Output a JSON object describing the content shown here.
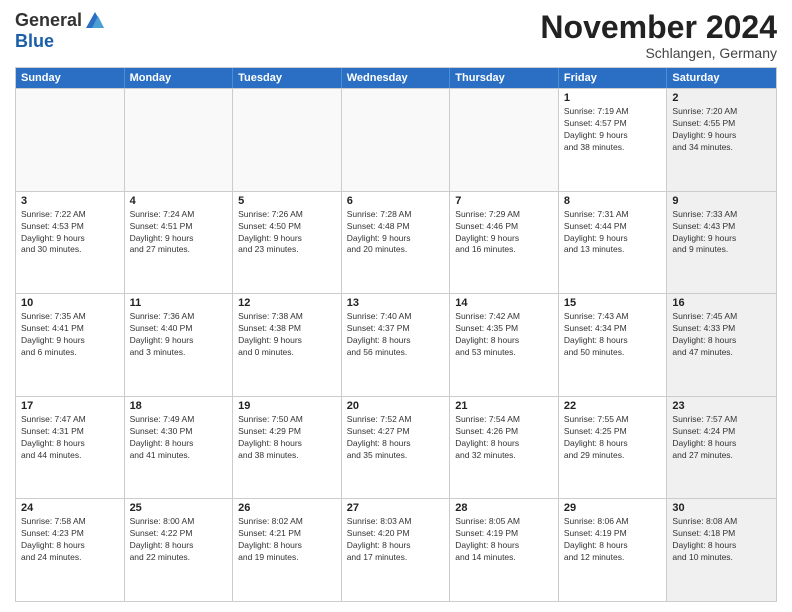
{
  "logo": {
    "line1": "General",
    "line2": "Blue"
  },
  "title": "November 2024",
  "subtitle": "Schlangen, Germany",
  "header_days": [
    "Sunday",
    "Monday",
    "Tuesday",
    "Wednesday",
    "Thursday",
    "Friday",
    "Saturday"
  ],
  "weeks": [
    [
      {
        "day": "",
        "info": "",
        "shaded": false,
        "empty": true
      },
      {
        "day": "",
        "info": "",
        "shaded": false,
        "empty": true
      },
      {
        "day": "",
        "info": "",
        "shaded": false,
        "empty": true
      },
      {
        "day": "",
        "info": "",
        "shaded": false,
        "empty": true
      },
      {
        "day": "",
        "info": "",
        "shaded": false,
        "empty": true
      },
      {
        "day": "1",
        "info": "Sunrise: 7:19 AM\nSunset: 4:57 PM\nDaylight: 9 hours\nand 38 minutes.",
        "shaded": false,
        "empty": false
      },
      {
        "day": "2",
        "info": "Sunrise: 7:20 AM\nSunset: 4:55 PM\nDaylight: 9 hours\nand 34 minutes.",
        "shaded": true,
        "empty": false
      }
    ],
    [
      {
        "day": "3",
        "info": "Sunrise: 7:22 AM\nSunset: 4:53 PM\nDaylight: 9 hours\nand 30 minutes.",
        "shaded": false,
        "empty": false
      },
      {
        "day": "4",
        "info": "Sunrise: 7:24 AM\nSunset: 4:51 PM\nDaylight: 9 hours\nand 27 minutes.",
        "shaded": false,
        "empty": false
      },
      {
        "day": "5",
        "info": "Sunrise: 7:26 AM\nSunset: 4:50 PM\nDaylight: 9 hours\nand 23 minutes.",
        "shaded": false,
        "empty": false
      },
      {
        "day": "6",
        "info": "Sunrise: 7:28 AM\nSunset: 4:48 PM\nDaylight: 9 hours\nand 20 minutes.",
        "shaded": false,
        "empty": false
      },
      {
        "day": "7",
        "info": "Sunrise: 7:29 AM\nSunset: 4:46 PM\nDaylight: 9 hours\nand 16 minutes.",
        "shaded": false,
        "empty": false
      },
      {
        "day": "8",
        "info": "Sunrise: 7:31 AM\nSunset: 4:44 PM\nDaylight: 9 hours\nand 13 minutes.",
        "shaded": false,
        "empty": false
      },
      {
        "day": "9",
        "info": "Sunrise: 7:33 AM\nSunset: 4:43 PM\nDaylight: 9 hours\nand 9 minutes.",
        "shaded": true,
        "empty": false
      }
    ],
    [
      {
        "day": "10",
        "info": "Sunrise: 7:35 AM\nSunset: 4:41 PM\nDaylight: 9 hours\nand 6 minutes.",
        "shaded": false,
        "empty": false
      },
      {
        "day": "11",
        "info": "Sunrise: 7:36 AM\nSunset: 4:40 PM\nDaylight: 9 hours\nand 3 minutes.",
        "shaded": false,
        "empty": false
      },
      {
        "day": "12",
        "info": "Sunrise: 7:38 AM\nSunset: 4:38 PM\nDaylight: 9 hours\nand 0 minutes.",
        "shaded": false,
        "empty": false
      },
      {
        "day": "13",
        "info": "Sunrise: 7:40 AM\nSunset: 4:37 PM\nDaylight: 8 hours\nand 56 minutes.",
        "shaded": false,
        "empty": false
      },
      {
        "day": "14",
        "info": "Sunrise: 7:42 AM\nSunset: 4:35 PM\nDaylight: 8 hours\nand 53 minutes.",
        "shaded": false,
        "empty": false
      },
      {
        "day": "15",
        "info": "Sunrise: 7:43 AM\nSunset: 4:34 PM\nDaylight: 8 hours\nand 50 minutes.",
        "shaded": false,
        "empty": false
      },
      {
        "day": "16",
        "info": "Sunrise: 7:45 AM\nSunset: 4:33 PM\nDaylight: 8 hours\nand 47 minutes.",
        "shaded": true,
        "empty": false
      }
    ],
    [
      {
        "day": "17",
        "info": "Sunrise: 7:47 AM\nSunset: 4:31 PM\nDaylight: 8 hours\nand 44 minutes.",
        "shaded": false,
        "empty": false
      },
      {
        "day": "18",
        "info": "Sunrise: 7:49 AM\nSunset: 4:30 PM\nDaylight: 8 hours\nand 41 minutes.",
        "shaded": false,
        "empty": false
      },
      {
        "day": "19",
        "info": "Sunrise: 7:50 AM\nSunset: 4:29 PM\nDaylight: 8 hours\nand 38 minutes.",
        "shaded": false,
        "empty": false
      },
      {
        "day": "20",
        "info": "Sunrise: 7:52 AM\nSunset: 4:27 PM\nDaylight: 8 hours\nand 35 minutes.",
        "shaded": false,
        "empty": false
      },
      {
        "day": "21",
        "info": "Sunrise: 7:54 AM\nSunset: 4:26 PM\nDaylight: 8 hours\nand 32 minutes.",
        "shaded": false,
        "empty": false
      },
      {
        "day": "22",
        "info": "Sunrise: 7:55 AM\nSunset: 4:25 PM\nDaylight: 8 hours\nand 29 minutes.",
        "shaded": false,
        "empty": false
      },
      {
        "day": "23",
        "info": "Sunrise: 7:57 AM\nSunset: 4:24 PM\nDaylight: 8 hours\nand 27 minutes.",
        "shaded": true,
        "empty": false
      }
    ],
    [
      {
        "day": "24",
        "info": "Sunrise: 7:58 AM\nSunset: 4:23 PM\nDaylight: 8 hours\nand 24 minutes.",
        "shaded": false,
        "empty": false
      },
      {
        "day": "25",
        "info": "Sunrise: 8:00 AM\nSunset: 4:22 PM\nDaylight: 8 hours\nand 22 minutes.",
        "shaded": false,
        "empty": false
      },
      {
        "day": "26",
        "info": "Sunrise: 8:02 AM\nSunset: 4:21 PM\nDaylight: 8 hours\nand 19 minutes.",
        "shaded": false,
        "empty": false
      },
      {
        "day": "27",
        "info": "Sunrise: 8:03 AM\nSunset: 4:20 PM\nDaylight: 8 hours\nand 17 minutes.",
        "shaded": false,
        "empty": false
      },
      {
        "day": "28",
        "info": "Sunrise: 8:05 AM\nSunset: 4:19 PM\nDaylight: 8 hours\nand 14 minutes.",
        "shaded": false,
        "empty": false
      },
      {
        "day": "29",
        "info": "Sunrise: 8:06 AM\nSunset: 4:19 PM\nDaylight: 8 hours\nand 12 minutes.",
        "shaded": false,
        "empty": false
      },
      {
        "day": "30",
        "info": "Sunrise: 8:08 AM\nSunset: 4:18 PM\nDaylight: 8 hours\nand 10 minutes.",
        "shaded": true,
        "empty": false
      }
    ]
  ]
}
